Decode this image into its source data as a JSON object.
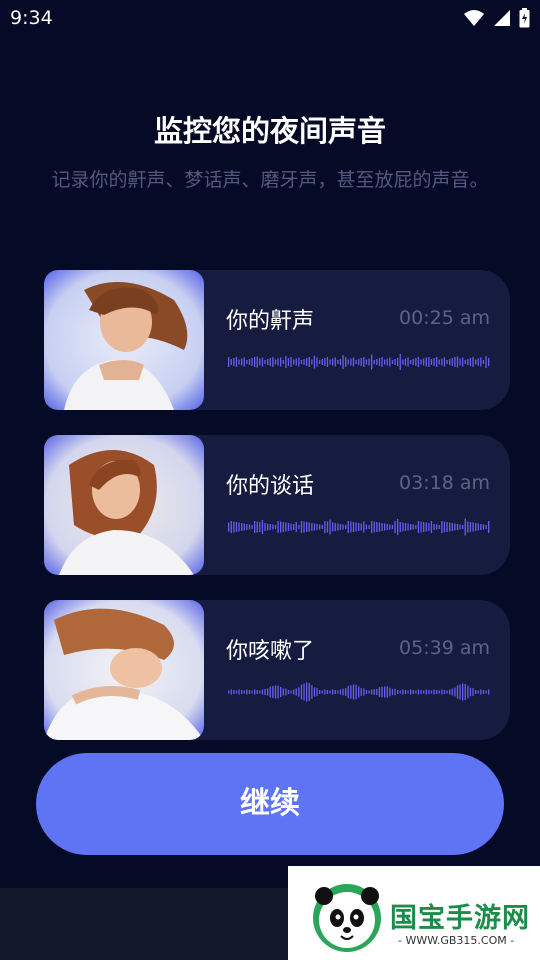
{
  "status": {
    "time": "9:34",
    "icons": [
      "wifi-icon",
      "signal-icon",
      "battery-icon"
    ]
  },
  "header": {
    "title": "监控您的夜间声音",
    "subtitle": "记录你的鼾声、梦话声、磨牙声，甚至放屁的声音。"
  },
  "recordings": [
    {
      "label": "你的鼾声",
      "time": "00:25 am"
    },
    {
      "label": "你的谈话",
      "time": "03:18 am"
    },
    {
      "label": "你咳嗽了",
      "time": "05:39 am"
    }
  ],
  "continue_label": "继续",
  "watermark": {
    "text": "国宝手游网",
    "url": "- WWW.GB315.COM -"
  },
  "colors": {
    "background": "#050a26",
    "card": "#161c3f",
    "accent": "#5f73f5",
    "wave": "#6a5cf0"
  }
}
